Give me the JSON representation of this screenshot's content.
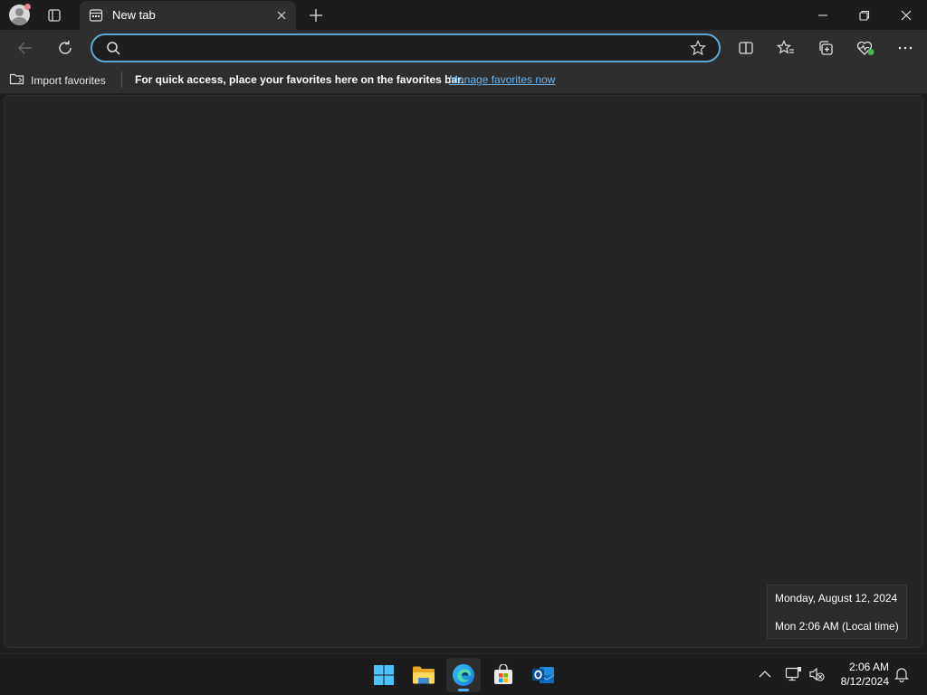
{
  "browser": {
    "tab": {
      "title": "New tab",
      "icon": "new-tab-page-icon"
    },
    "new_tab_icon": "plus-icon",
    "window_controls": [
      "minimize-icon",
      "restore-icon",
      "close-icon"
    ]
  },
  "toolbar": {
    "back_icon": "arrow-left-icon",
    "refresh_icon": "refresh-icon",
    "address": {
      "value": "",
      "placeholder": "",
      "search_icon": "search-icon",
      "favorite_icon": "star-icon"
    },
    "right_icons": [
      "split-screen-icon",
      "favorites-icon",
      "collections-icon",
      "browser-essentials-icon",
      "more-icon"
    ]
  },
  "favorites_bar": {
    "import_label": "Import favorites",
    "hint": "For quick access, place your favorites here on the favorites bar.",
    "manage_link": "Manage favorites now"
  },
  "clock_tooltip": {
    "date_line": "Monday, August 12, 2024",
    "time_line": "Mon 2:06 AM (Local time)"
  },
  "taskbar": {
    "apps": [
      {
        "name": "start-button",
        "icon": "windows-logo-icon",
        "active": false
      },
      {
        "name": "file-explorer",
        "icon": "folder-icon",
        "active": false
      },
      {
        "name": "microsoft-edge",
        "icon": "edge-icon",
        "active": true
      },
      {
        "name": "microsoft-store",
        "icon": "store-icon",
        "active": false
      },
      {
        "name": "outlook",
        "icon": "outlook-icon",
        "active": false
      }
    ],
    "tray": {
      "time": "2:06 AM",
      "date": "8/12/2024",
      "icons": [
        "chevron-up-icon",
        "network-icon",
        "volume-muted-icon",
        "notification-bell-icon"
      ]
    }
  },
  "colors": {
    "accent": "#5fa8d3",
    "link": "#6ab4f0",
    "edge_indicator": "#5fb2f2"
  }
}
